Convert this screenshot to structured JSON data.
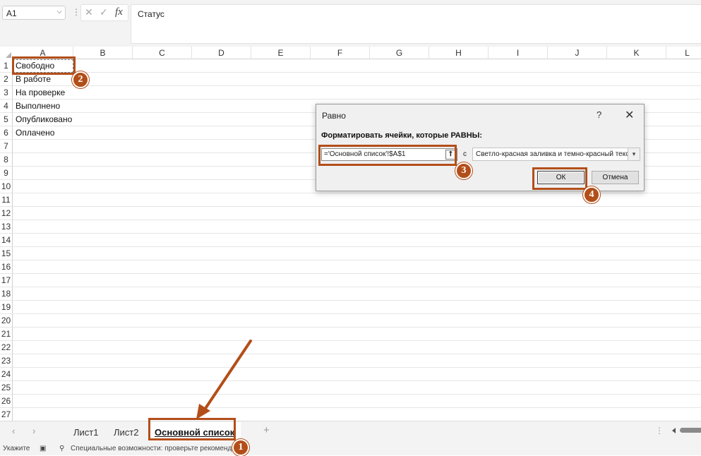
{
  "formula_bar": {
    "name_box": "A1",
    "fx_label": "fx",
    "formula": "Статус"
  },
  "grid": {
    "columns": [
      "A",
      "B",
      "C",
      "D",
      "E",
      "F",
      "G",
      "H",
      "I",
      "J",
      "K",
      "L"
    ],
    "rows": [
      "1",
      "2",
      "3",
      "4",
      "5",
      "6",
      "7",
      "8",
      "9",
      "10",
      "11",
      "12",
      "13",
      "14",
      "15",
      "16",
      "17",
      "18",
      "19",
      "20",
      "21",
      "22",
      "23",
      "24",
      "25",
      "26",
      "27"
    ],
    "column_a": [
      "Свободно",
      "В работе",
      "На проверке",
      "Выполнено",
      "Опубликовано",
      "Оплачено"
    ]
  },
  "dialog": {
    "title": "Равно",
    "help": "?",
    "close": "✕",
    "prompt": "Форматировать ячейки, которые РАВНЫ:",
    "reference_value": "='Основной список'!$A$1",
    "with_label": "с",
    "format_value": "Светло-красная заливка и темно-красный текст",
    "ok_label": "ОК",
    "cancel_label": "Отмена"
  },
  "sheet_tabs": {
    "tabs": [
      "Лист1",
      "Лист2",
      "Основной список"
    ],
    "active": "Основной список",
    "add_label": "+"
  },
  "status_bar": {
    "mode": "Укажите",
    "accessibility": "Специальные возможности: проверьте рекомендац"
  },
  "annotations": {
    "badges": [
      "1",
      "2",
      "3",
      "4"
    ],
    "color": "#b34e19"
  }
}
